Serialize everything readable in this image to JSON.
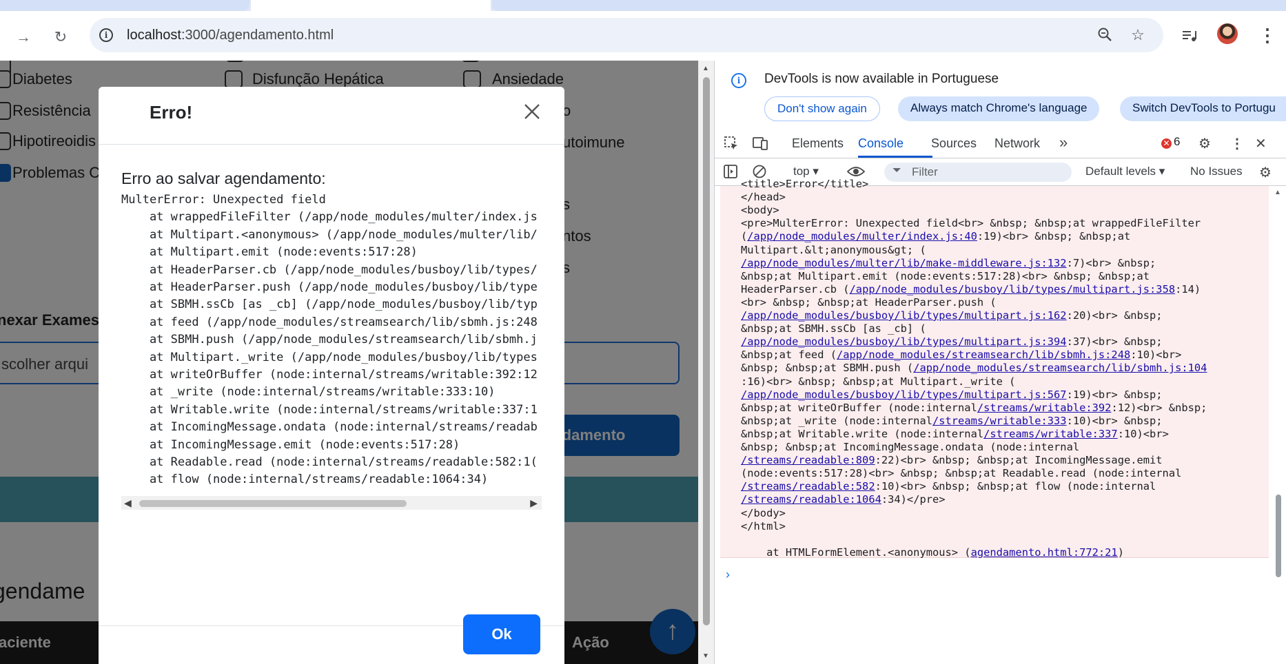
{
  "browser": {
    "url_host": "localhost",
    "url_path": ":3000/agendamento.html"
  },
  "page": {
    "checkbox_labels": {
      "c1r1": "Diabetes",
      "c2r1": "Disfunção Hepática",
      "c3r1": "Ansiedade",
      "c1r2": "Resistência",
      "c3r2": "o",
      "c1r3": "Hipotireoidis",
      "c3r3": "utoimune",
      "c1r4": "Problemas C",
      "c3r5": "s",
      "c3r6": "ntos",
      "c3r7": "s"
    },
    "exams_label": "nexar Exames",
    "file_input_text": "scolher arqui",
    "submit_label": "endamento",
    "agendamentos_title": "gendame",
    "table_headers": {
      "paciente": "aciente",
      "acao": "Ação"
    }
  },
  "modal": {
    "title": "Erro!",
    "message": "Erro ao salvar agendamento:",
    "stack_lines": [
      "MulterError: Unexpected field",
      "    at wrappedFileFilter (/app/node_modules/multer/index.js",
      "    at Multipart.<anonymous> (/app/node_modules/multer/lib/",
      "    at Multipart.emit (node:events:517:28)",
      "    at HeaderParser.cb (/app/node_modules/busboy/lib/types/",
      "    at HeaderParser.push (/app/node_modules/busboy/lib/type",
      "    at SBMH.ssCb [as _cb] (/app/node_modules/busboy/lib/typ",
      "    at feed (/app/node_modules/streamsearch/lib/sbmh.js:248",
      "    at SBMH.push (/app/node_modules/streamsearch/lib/sbmh.j",
      "    at Multipart._write (/app/node_modules/busboy/lib/types",
      "    at writeOrBuffer (node:internal/streams/writable:392:12",
      "    at _write (node:internal/streams/writable:333:10)",
      "    at Writable.write (node:internal/streams/writable:337:1",
      "    at IncomingMessage.ondata (node:internal/streams/readab",
      "    at IncomingMessage.emit (node:events:517:28)",
      "    at Readable.read (node:internal/streams/readable:582:1(",
      "    at flow (node:internal/streams/readable:1064:34)"
    ],
    "ok_label": "Ok"
  },
  "devtools": {
    "info_message": "DevTools is now available in Portuguese",
    "btn_dont_show": "Don't show again",
    "btn_match_language": "Always match Chrome's language",
    "btn_switch": "Switch DevTools to Portugu",
    "tabs": [
      "Elements",
      "Console",
      "Sources",
      "Network"
    ],
    "active_tab": "Console",
    "error_count": "6",
    "context": "top",
    "filter_placeholder": "Filter",
    "levels": "Default levels",
    "issues": "No Issues",
    "console_lines": [
      [
        {
          "t": "<title>Error</title>"
        }
      ],
      [
        {
          "t": "</head>"
        }
      ],
      [
        {
          "t": "<body>"
        }
      ],
      [
        {
          "t": "<pre>MulterError: Unexpected field<br> &nbsp; &nbsp;at wrappedFileFilter"
        }
      ],
      [
        {
          "t": "("
        },
        {
          "t": "/app/node_modules/multer/index.js:40",
          "link": true
        },
        {
          "t": ":19)<br> &nbsp; &nbsp;at"
        }
      ],
      [
        {
          "t": "Multipart.&lt;anonymous&gt; ("
        }
      ],
      [
        {
          "t": "/app/node_modules/multer/lib/make-middleware.js:132",
          "link": true
        },
        {
          "t": ":7)<br> &nbsp;"
        }
      ],
      [
        {
          "t": "&nbsp;at Multipart.emit (node:events:517:28)<br> &nbsp; &nbsp;at"
        }
      ],
      [
        {
          "t": "HeaderParser.cb ("
        },
        {
          "t": "/app/node_modules/busboy/lib/types/multipart.js:358",
          "link": true
        },
        {
          "t": ":14)"
        }
      ],
      [
        {
          "t": "<br> &nbsp; &nbsp;at HeaderParser.push ("
        }
      ],
      [
        {
          "t": "/app/node_modules/busboy/lib/types/multipart.js:162",
          "link": true
        },
        {
          "t": ":20)<br> &nbsp;"
        }
      ],
      [
        {
          "t": "&nbsp;at SBMH.ssCb [as _cb] ("
        }
      ],
      [
        {
          "t": "/app/node_modules/busboy/lib/types/multipart.js:394",
          "link": true
        },
        {
          "t": ":37)<br> &nbsp;"
        }
      ],
      [
        {
          "t": "&nbsp;at feed ("
        },
        {
          "t": "/app/node_modules/streamsearch/lib/sbmh.js:248",
          "link": true
        },
        {
          "t": ":10)<br>"
        }
      ],
      [
        {
          "t": "&nbsp; &nbsp;at SBMH.push ("
        },
        {
          "t": "/app/node_modules/streamsearch/lib/sbmh.js:104",
          "link": true
        }
      ],
      [
        {
          "t": ":16)<br> &nbsp; &nbsp;at Multipart._write ("
        }
      ],
      [
        {
          "t": "/app/node_modules/busboy/lib/types/multipart.js:567",
          "link": true
        },
        {
          "t": ":19)<br> &nbsp;"
        }
      ],
      [
        {
          "t": "&nbsp;at writeOrBuffer (node:internal"
        },
        {
          "t": "/streams/writable:392",
          "link": true
        },
        {
          "t": ":12)<br> &nbsp;"
        }
      ],
      [
        {
          "t": "&nbsp;at _write (node:internal"
        },
        {
          "t": "/streams/writable:333",
          "link": true
        },
        {
          "t": ":10)<br> &nbsp;"
        }
      ],
      [
        {
          "t": "&nbsp;at Writable.write (node:internal"
        },
        {
          "t": "/streams/writable:337",
          "link": true
        },
        {
          "t": ":10)<br>"
        }
      ],
      [
        {
          "t": "&nbsp; &nbsp;at IncomingMessage.ondata (node:internal"
        }
      ],
      [
        {
          "t": "/streams/readable:809",
          "link": true
        },
        {
          "t": ":22)<br> &nbsp; &nbsp;at IncomingMessage.emit"
        }
      ],
      [
        {
          "t": "(node:events:517:28)<br> &nbsp; &nbsp;at Readable.read (node:internal"
        }
      ],
      [
        {
          "t": "/streams/readable:582",
          "link": true
        },
        {
          "t": ":10)<br> &nbsp; &nbsp;at flow (node:internal"
        }
      ],
      [
        {
          "t": "/streams/readable:1064",
          "link": true
        },
        {
          "t": ":34)</pre>"
        }
      ],
      [
        {
          "t": "</body>"
        }
      ],
      [
        {
          "t": "</html>"
        }
      ],
      [
        {
          "t": ""
        }
      ],
      [
        {
          "t": "    at HTMLFormElement.<anonymous> ("
        },
        {
          "t": "agendamento.html:772:21",
          "link": true
        },
        {
          "t": ")"
        }
      ]
    ]
  }
}
